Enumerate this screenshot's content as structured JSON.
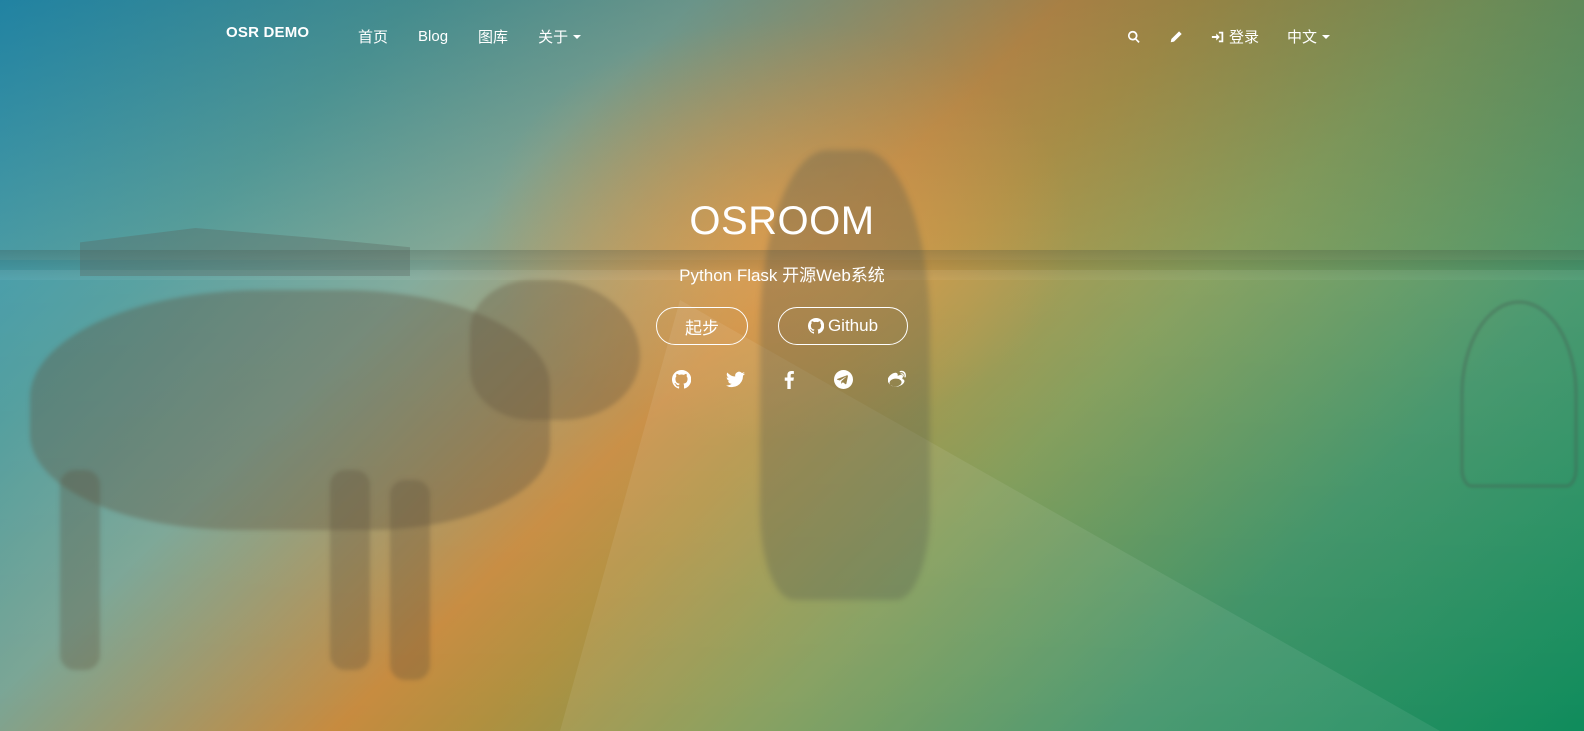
{
  "brand": "OSR DEMO",
  "nav": {
    "left": [
      {
        "label": "首页",
        "dropdown": false
      },
      {
        "label": "Blog",
        "dropdown": false
      },
      {
        "label": "图库",
        "dropdown": false
      },
      {
        "label": "关于",
        "dropdown": true
      }
    ],
    "right": {
      "search_icon": "search-icon",
      "edit_icon": "pencil-icon",
      "login_icon": "sign-in-icon",
      "login_label": "登录",
      "language_label": "中文"
    }
  },
  "hero": {
    "title": "OSROOM",
    "subtitle": "Python Flask 开源Web系统",
    "start_button": "起步",
    "github_button": "Github",
    "social_icons": [
      "github-icon",
      "twitter-icon",
      "facebook-icon",
      "telegram-icon",
      "weibo-icon"
    ]
  },
  "colors": {
    "gradient_start": "#1f8fb4",
    "gradient_mid": "#c78b3f",
    "gradient_end": "#0f8c5c",
    "text": "#ffffff"
  }
}
